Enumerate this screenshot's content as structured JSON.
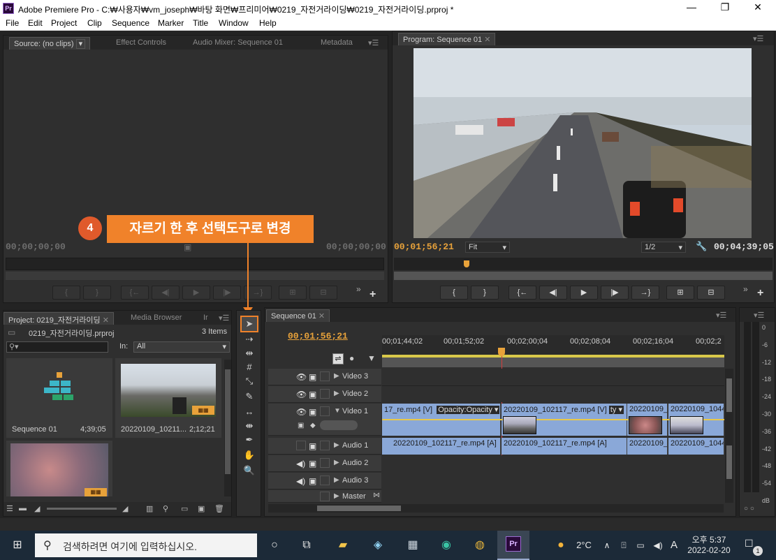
{
  "window": {
    "title": "Adobe Premiere Pro - C:₩사용자₩vm_joseph₩바탕 화면₩프리미어₩0219_자전거라이딩₩0219_자전거라이딩.prproj *",
    "minimize": "—",
    "maximize": "❐",
    "close": "✕"
  },
  "menu": [
    "File",
    "Edit",
    "Project",
    "Clip",
    "Sequence",
    "Marker",
    "Title",
    "Window",
    "Help"
  ],
  "source_panel": {
    "tabs": [
      "Source: (no clips)",
      "Effect Controls",
      "Audio Mixer: Sequence 01",
      "Metadata"
    ],
    "tc_left": "00;00;00;00",
    "tc_right": "00;00;00;00"
  },
  "program_panel": {
    "tab": "Program: Sequence 01",
    "tc_current": "00;01;56;21",
    "fit": "Fit",
    "quality": "1/2",
    "tc_duration": "00;04;39;05"
  },
  "callout": {
    "step": "4",
    "text": "자르기 한 후 선택도구로 변경"
  },
  "project_panel": {
    "tabs": [
      "Project: 0219_자전거라이딩",
      "Media Browser",
      "Ir"
    ],
    "file": "0219_자전거라이딩.prproj",
    "items_count": "3 Items",
    "in_label": "In:",
    "in_value": "All",
    "items": [
      {
        "name": "Sequence 01",
        "duration": "4;39;05"
      },
      {
        "name": "20220109_10211...",
        "duration": "2;12;21"
      }
    ]
  },
  "timeline": {
    "tab": "Sequence 01",
    "tc": "00;01;56;21",
    "ruler": [
      "00;01;44;02",
      "00;01;52;02",
      "00;02;00;04",
      "00;02;08;04",
      "00;02;16;04",
      "00;02;2"
    ],
    "tracks": [
      "Video 3",
      "Video 2",
      "Video 1",
      "Audio 1",
      "Audio 2",
      "Audio 3",
      "Master"
    ],
    "video_clips": [
      "17_re.mp4 [V]",
      "Opacity:Opacity ▾",
      "20220109_102117_re.mp4 [V]",
      "ty ▾",
      "20220109_",
      "20220109_1044"
    ],
    "audio_clips": [
      "20220109_102117_re.mp4 [A]",
      "20220109_102117_re.mp4 [A]",
      "20220109_",
      "20220109_1044"
    ]
  },
  "meter": {
    "labels": [
      "0",
      "-6",
      "-12",
      "-18",
      "-24",
      "-30",
      "-36",
      "-42",
      "-48",
      "-54",
      "dB"
    ]
  },
  "taskbar": {
    "search_placeholder": "검색하려면 여기에 입력하십시오.",
    "weather": "2°C",
    "ime": "A",
    "time": "오후 5:37",
    "date": "2022-02-20",
    "notif": "1"
  },
  "colors": {
    "accent_orange": "#e8a23a",
    "callout_orange": "#f0822a",
    "clip_blue": "#8aa8d8"
  }
}
